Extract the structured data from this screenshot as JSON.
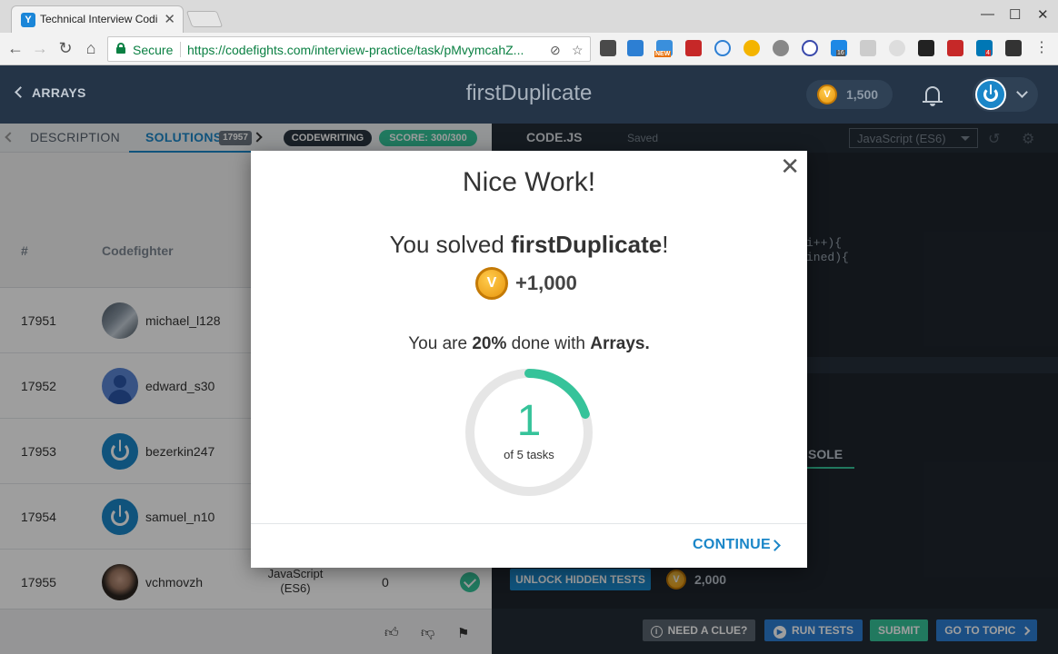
{
  "browser": {
    "tab_title": "Technical Interview Codi",
    "url": "https://codefights.com/interview-practice/task/pMvymcahZ...",
    "secure_label": "Secure",
    "extension_badges": [
      "NEW",
      "16",
      "4"
    ]
  },
  "header": {
    "back_label": "ARRAYS",
    "task_title": "firstDuplicate",
    "coins": "1,500"
  },
  "left_panel": {
    "tabs": {
      "description": "DESCRIPTION",
      "solutions": "SOLUTIONS",
      "solutions_count": "17957",
      "mode_badge": "CODEWRITING",
      "score_badge": "SCORE: 300/300"
    },
    "table": {
      "col_num": "#",
      "col_user": "Codefighter",
      "rows": [
        {
          "num": "17951",
          "user": "michael_l128"
        },
        {
          "num": "17952",
          "user": "edward_s30"
        },
        {
          "num": "17953",
          "user": "bezerkin247"
        },
        {
          "num": "17954",
          "user": "samuel_n10"
        },
        {
          "num": "17955",
          "user": "vchmovzh",
          "lang": "JavaScript (ES6)",
          "score": "0"
        }
      ]
    }
  },
  "editor": {
    "file_tab": "CODE.JS",
    "save_status": "Saved",
    "language": "JavaScript (ES6)",
    "code_fragments": [
      "i++){",
      "ined){"
    ],
    "console_tab": "SOLE",
    "unlock_label": "UNLOCK HIDDEN TESTS",
    "unlock_cost": "2,000",
    "actions": {
      "clue": "NEED A CLUE?",
      "run": "RUN TESTS",
      "submit": "SUBMIT",
      "topic": "GO TO TOPIC"
    }
  },
  "modal": {
    "title": "Nice Work!",
    "solved_prefix": "You solved ",
    "solved_task": "firstDuplicate",
    "solved_suffix": "!",
    "reward": "+1,000",
    "progress_prefix": "You are ",
    "progress_pct": "20%",
    "progress_mid": " done with ",
    "progress_topic": "Arrays.",
    "tasks_done": "1",
    "tasks_label": "of 5 tasks",
    "progress_fraction": 0.2,
    "continue_label": "CONTINUE"
  },
  "colors": {
    "accent": "#1a86c8",
    "success": "#36c39a",
    "header_bg": "#243447"
  }
}
